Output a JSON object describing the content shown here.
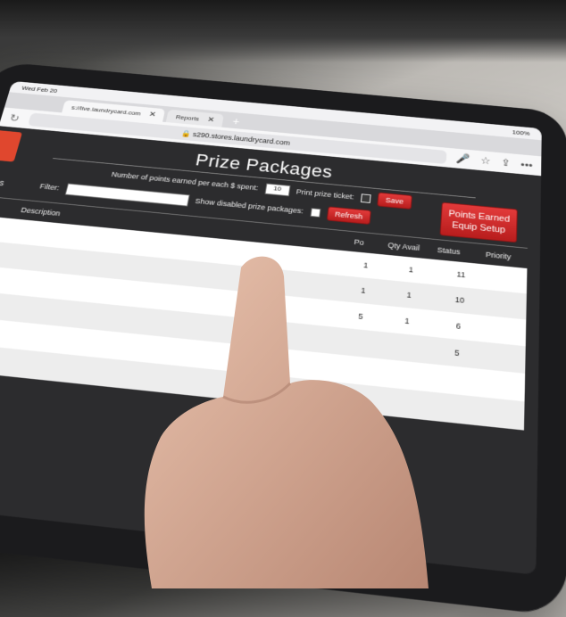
{
  "statusbar": {
    "time": "Wed Feb 20",
    "signal": "100%"
  },
  "browser": {
    "tabs": [
      {
        "label": "s://live.laundrycard.com",
        "active": true
      },
      {
        "label": "Reports",
        "active": false
      }
    ],
    "url": "s290.stores.laundrycard.com",
    "tab_count": "2"
  },
  "app": {
    "title": "Prize Packages",
    "points_label": "Number of points earned per each $ spent:",
    "points_value": "10",
    "print_ticket_label": "Print prize ticket:",
    "save_label": "Save",
    "filter_label": "Filter:",
    "filter_value": "",
    "show_disabled_label": "Show disabled prize packages:",
    "refresh_label": "Refresh",
    "points_earned_label": "Points Earned Equip Setup",
    "side_label": "ages"
  },
  "table": {
    "headers": {
      "description": "Description",
      "points": "Po",
      "qty": "Qty Avail",
      "status": "Status",
      "priority": "Priority"
    },
    "rows": [
      {
        "qty": "1",
        "status": "1",
        "priority": "11"
      },
      {
        "qty": "1",
        "status": "1",
        "priority": "10"
      },
      {
        "qty": "5",
        "status": "1",
        "priority": "6"
      },
      {
        "qty": "",
        "status": "",
        "priority": "5"
      },
      {
        "qty": "",
        "status": "",
        "priority": ""
      },
      {
        "qty": "",
        "status": "",
        "priority": ""
      }
    ]
  },
  "colors": {
    "accent_red": "#d12b2b",
    "orange": "#e0472e",
    "app_bg": "#2c2c2e"
  }
}
